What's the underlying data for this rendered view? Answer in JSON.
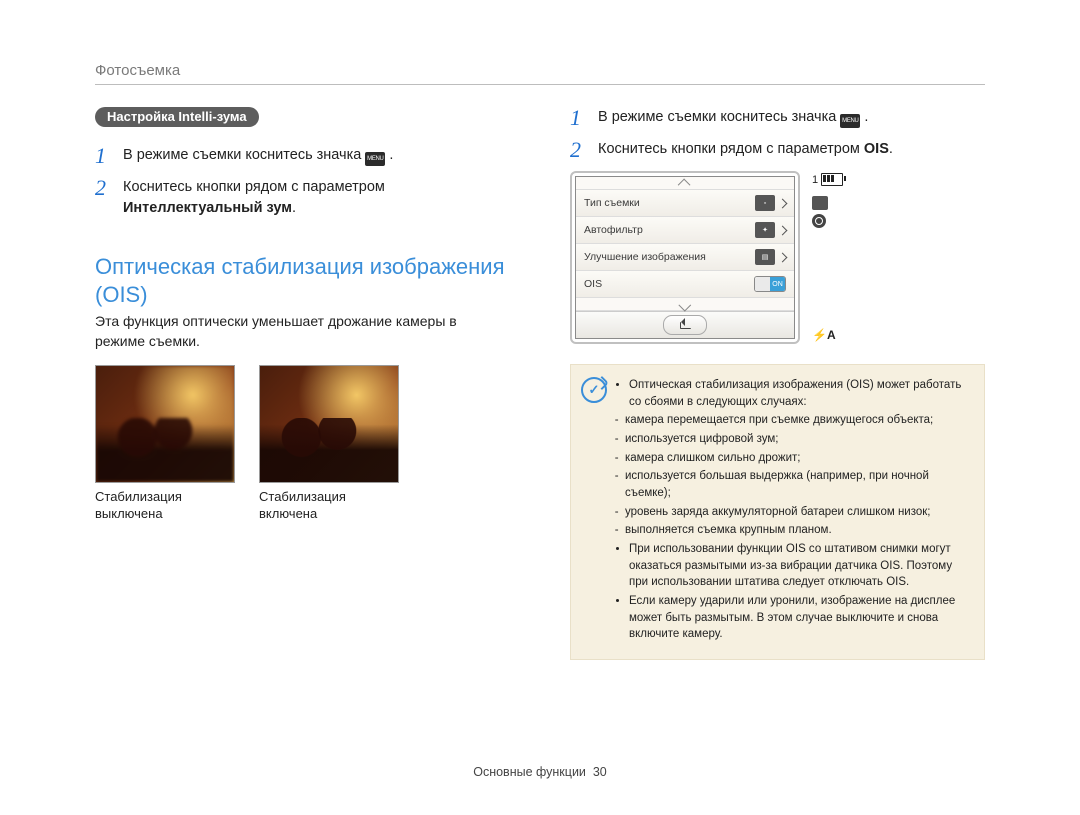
{
  "header": {
    "breadcrumb": "Фотосъемка"
  },
  "left": {
    "pill_label": "Настройка Intelli-зума",
    "steps": [
      {
        "num": "1",
        "pre": "В режиме съемки коснитесь значка ",
        "badge": "MENU",
        "post": "."
      },
      {
        "num": "2",
        "text": "Коснитесь кнопки рядом с параметром ",
        "bold_tail": "Интеллектуальный зум",
        "tail_post": "."
      }
    ],
    "section_title": "Оптическая стабилизация изображения (OIS)",
    "section_body": "Эта функция оптически уменьшает дрожание камеры в режиме съемки.",
    "photos": {
      "off_caption": "Стабилизация выключена",
      "on_caption": "Стабилизация включена"
    }
  },
  "right": {
    "steps": [
      {
        "num": "1",
        "pre": "В режиме съемки коснитесь значка ",
        "badge": "MENU",
        "post": "."
      },
      {
        "num": "2",
        "text_pre": "Коснитесь кнопки рядом с параметром ",
        "bold": "OIS",
        "text_post": "."
      }
    ],
    "camera": {
      "rows": [
        {
          "label": "Тип съемки",
          "control": "chevron"
        },
        {
          "label": "Автофильтр",
          "control": "chevron"
        },
        {
          "label": "Улучшение изображения",
          "control": "chevron"
        },
        {
          "label": "OIS",
          "control": "toggle",
          "toggle_on": "ON"
        }
      ],
      "side": {
        "page_indicator": "1",
        "flash_label": "A"
      }
    },
    "note": {
      "bullets": [
        "Оптическая стабилизация изображения (OIS) может работать со сбоями в следующих случаях:",
        "При использовании функции OIS со штативом снимки могут оказаться размытыми из-за вибрации датчика OIS. Поэтому при использовании штатива следует отключать OIS.",
        "Если камеру ударили или уронили, изображение на дисплее может быть размытым. В этом случае выключите и снова включите камеру."
      ],
      "sub_bullets": [
        "камера перемещается при съемке движущегося объекта;",
        "используется цифровой зум;",
        "камера слишком сильно дрожит;",
        "используется большая выдержка (например, при ночной съемке);",
        "уровень заряда аккумуляторной батареи слишком низок;",
        "выполняется съемка крупным планом."
      ]
    }
  },
  "footer": {
    "section": "Основные функции",
    "page": "30"
  }
}
